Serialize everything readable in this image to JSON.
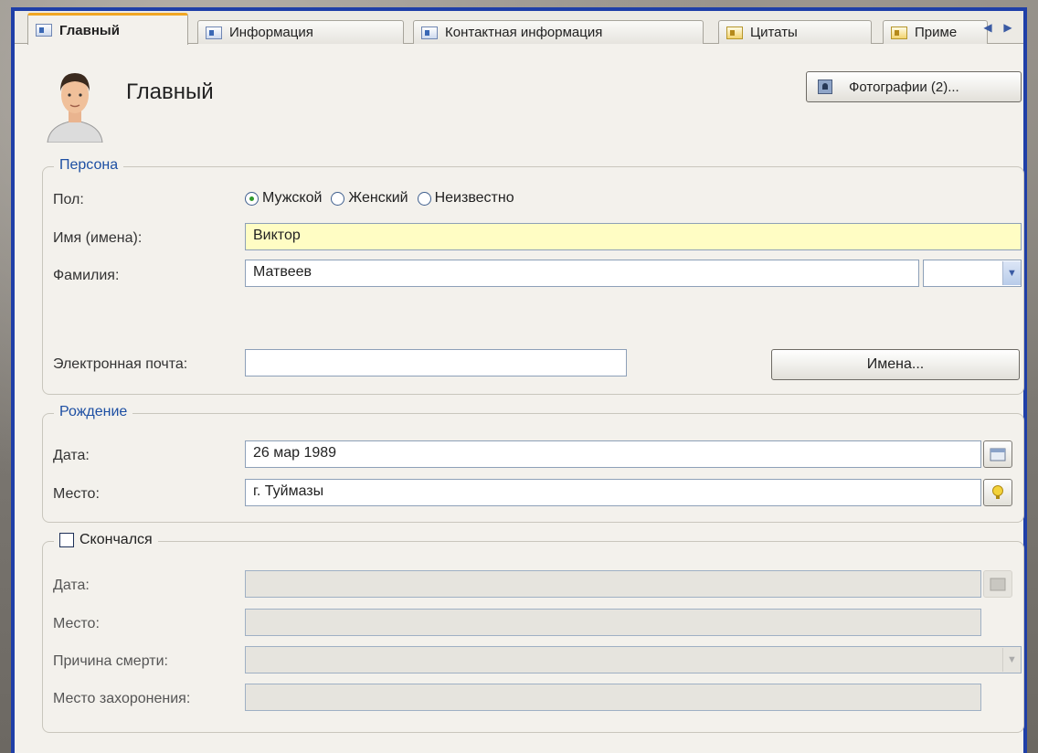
{
  "tabs": [
    {
      "label": "Главный",
      "icon": "person-card-icon"
    },
    {
      "label": "Информация",
      "icon": "info-icon"
    },
    {
      "label": "Контактная информация",
      "icon": "home-icon"
    },
    {
      "label": "Цитаты",
      "icon": "quote-icon"
    },
    {
      "label": "Приме",
      "icon": "note-icon"
    }
  ],
  "header": {
    "title": "Главный",
    "photos_button": "Фотографии (2)..."
  },
  "person": {
    "legend": "Персона",
    "gender_label": "Пол:",
    "gender_options": [
      "Мужской",
      "Женский",
      "Неизвестно"
    ],
    "selected_gender": "Мужской",
    "given_names_label": "Имя (имена):",
    "given_names_value": "Виктор",
    "surname_label": "Фамилия:",
    "surname_value": "Матвеев",
    "suffix_value": "",
    "email_label": "Электронная почта:",
    "email_value": "",
    "names_button": "Имена..."
  },
  "birth": {
    "legend": "Рождение",
    "date_label": "Дата:",
    "date_value": "26 мар 1989",
    "place_label": "Место:",
    "place_value": "г. Туймазы"
  },
  "death": {
    "checkbox_label": "Скончался",
    "checked": false,
    "date_label": "Дата:",
    "place_label": "Место:",
    "cause_label": "Причина смерти:",
    "burial_label": "Место захоронения:"
  },
  "colors": {
    "accent_tab": "#f0a623",
    "frame": "#1f3fa8",
    "legend": "#1d4fa3",
    "highlight_field": "#fffdc4"
  }
}
